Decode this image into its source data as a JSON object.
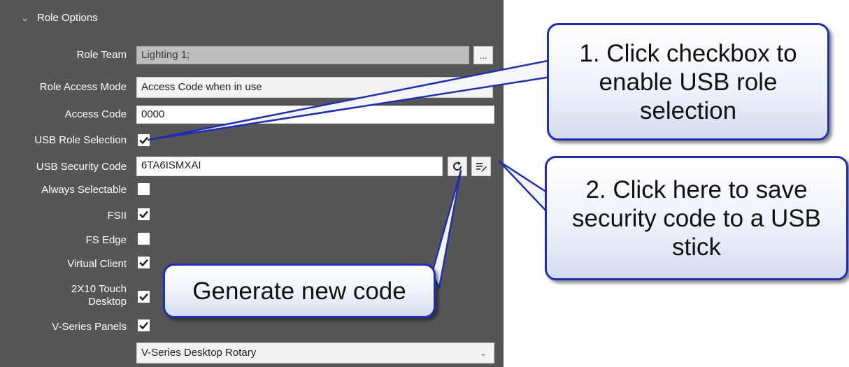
{
  "panel": {
    "title": "Role Options",
    "labels": {
      "role_team": "Role Team",
      "role_access_mode": "Role Access Mode",
      "access_code": "Access Code",
      "usb_role_selection": "USB Role Selection",
      "usb_security_code": "USB Security Code",
      "always_selectable": "Always Selectable",
      "fsii": "FSII",
      "fs_edge": "FS Edge",
      "virtual_client": "Virtual Client",
      "touch_desktop": "2X10 Touch Desktop",
      "v_series_panels": "V-Series Panels"
    },
    "fields": {
      "role_team_value": "Lighting 1;",
      "role_team_button": "...",
      "role_access_mode_value": "Access Code when in use",
      "access_code_value": "0000",
      "usb_security_code_value": "6TA6ISMXAI",
      "v_series_select_value": "V-Series Desktop Rotary"
    },
    "checkboxes": {
      "usb_role_selection": true,
      "always_selectable": false,
      "fsii": true,
      "fs_edge": false,
      "virtual_client": true,
      "touch_desktop": true,
      "v_series_panels": true
    },
    "icons": {
      "header_chevron": "chevron-down-icon",
      "generate": "refresh-icon",
      "save_to_usb": "save-to-usb-icon",
      "select_chevron": "chevron-down-icon"
    }
  },
  "callouts": {
    "step1": "1. Click checkbox to enable USB role selection",
    "step2": "2. Click here to save security code to a USB stick",
    "generate": "Generate new code"
  },
  "colors": {
    "panel_bg": "#565656",
    "callout_border": "#1f2fb0",
    "checkbox_bg": "#ffffff"
  }
}
